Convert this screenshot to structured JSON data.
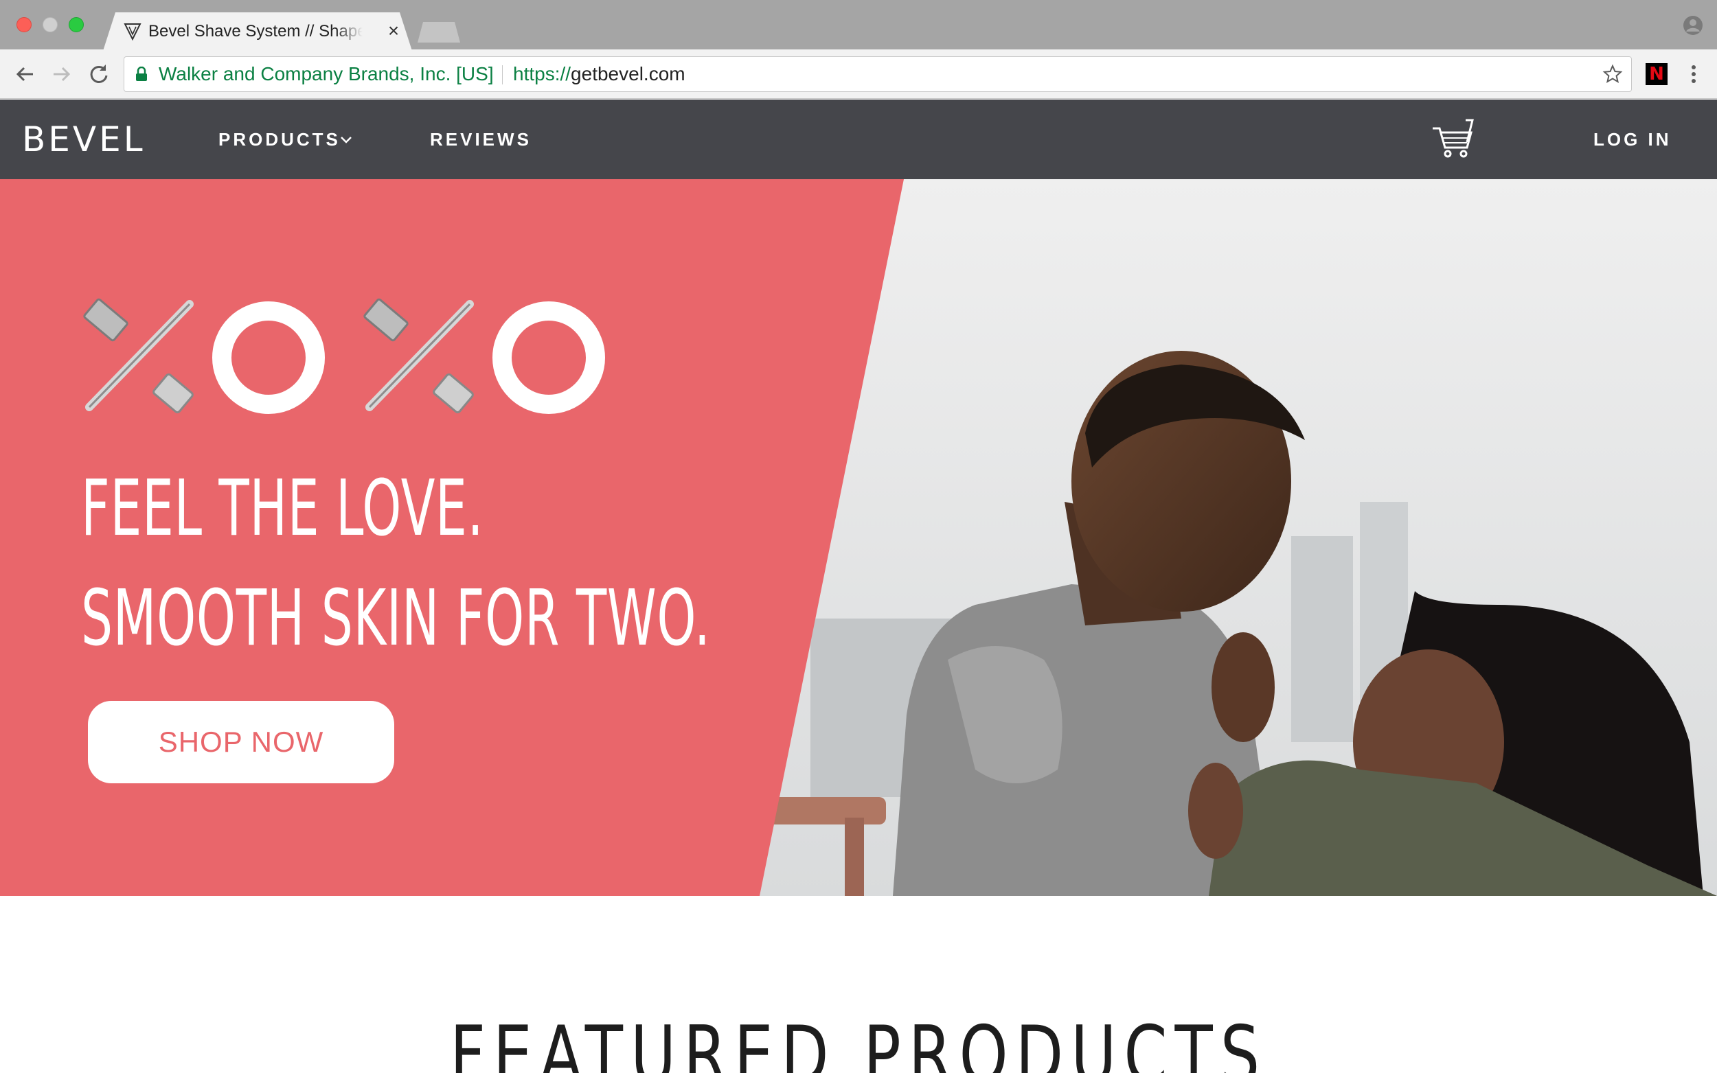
{
  "browser": {
    "tab": {
      "title": "Bevel Shave System // Shape Your Shave",
      "close_glyph": "×"
    },
    "omnibox": {
      "ev_label": "Walker and Company Brands, Inc. [US]",
      "url_scheme": "https://",
      "url_host": "getbevel.com"
    },
    "extension_letter": "N",
    "colors": {
      "secure_green": "#0b8043",
      "close": "#fc5f57",
      "maximize": "#2acb41"
    },
    "icons": [
      "back-icon",
      "forward-icon",
      "reload-icon",
      "lock-icon",
      "star-icon",
      "netflix-extension-icon",
      "menu-icon",
      "profile-icon"
    ]
  },
  "site": {
    "logo": "BEVEL",
    "nav": {
      "products": "PRODUCTS",
      "reviews": "REVIEWS",
      "login": "LOG IN"
    },
    "colors": {
      "nav_bg": "#45464b",
      "hero_pink": "#e9666b"
    }
  },
  "hero": {
    "headline_1": "FEEL THE LOVE.",
    "headline_2": "SMOOTH SKIN FOR TWO.",
    "cta": "SHOP NOW"
  },
  "featured": {
    "title": "FEATURED PRODUCTS"
  }
}
